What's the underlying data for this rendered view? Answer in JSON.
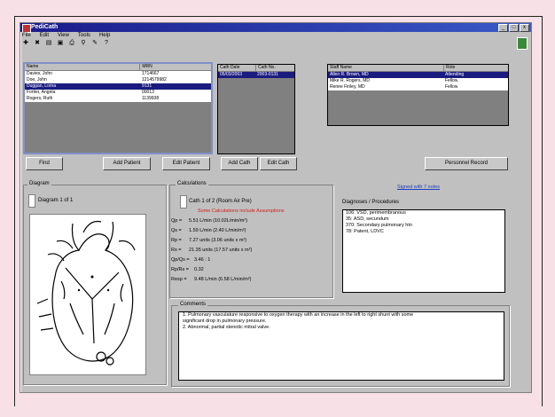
{
  "window": {
    "title": "PediCath",
    "titlebar_buttons": [
      "_",
      "□",
      "x"
    ],
    "menu": [
      "File",
      "Edit",
      "View",
      "Tools",
      "Help"
    ],
    "toolbar_icons": [
      "add-icon",
      "remove-icon",
      "database-icon",
      "save-icon",
      "print-icon",
      "search-icon",
      "tools-icon",
      "help-icon"
    ],
    "colors": {
      "title_gradient_start": "#1a1a8a",
      "selection": "#1b1b80",
      "highlight_text": "#d02020"
    }
  },
  "patients": {
    "columns": [
      "Name",
      "MRN"
    ],
    "rows": [
      {
        "name": "Davies, John",
        "mrn": "1714667"
      },
      {
        "name": "Doe, John",
        "mrn": "1214579982"
      },
      {
        "name": "Duggan, Lorna",
        "mrn": "9131"
      },
      {
        "name": "Fortier, Angela",
        "mrn": "00013"
      },
      {
        "name": "Rogers, Ruth",
        "mrn": "1139938"
      }
    ],
    "selected_index": 2
  },
  "caths": {
    "columns": [
      "Cath Date",
      "Cath No."
    ],
    "rows": [
      {
        "date": "05/03/2003",
        "number": "2003-0131"
      }
    ],
    "selected_index": 0
  },
  "staff": {
    "columns": [
      "Staff Name",
      "Role"
    ],
    "rows": [
      {
        "name": "Allen R. Brown, MD",
        "role": "Attending"
      },
      {
        "name": "Mike R. Rogers, MD",
        "role": "Fellow"
      },
      {
        "name": "Renee Finley, MD",
        "role": "Fellow"
      }
    ],
    "selected_index": 0
  },
  "buttons": {
    "find": "Find",
    "add_patient": "Add Patient",
    "edit_patient": "Edit Patient",
    "add_cath": "Add Cath",
    "edit_cath": "Edit Cath",
    "personnel_record": "Personnel Record"
  },
  "diagram": {
    "group_label": "Diagram",
    "page_label": "Diagram 1 of 1"
  },
  "calculations": {
    "group_label": "Calculations",
    "selector": "Cath 1 of 2 (Room Air Pre)",
    "note": "Some Calculations include Assumptions",
    "rows": [
      {
        "label": "Qp =",
        "value": "5.51 L/min (10.02L/min/m²)"
      },
      {
        "label": "Qs =",
        "value": "1.59 L/min (2.40 L/min/m²)"
      },
      {
        "label": "Rp =",
        "value": "7.27 units (3.06 units x m²)"
      },
      {
        "label": "Rs =",
        "value": "21.35 units (17.57 units x m²)"
      },
      {
        "label": "Qp/Qs =",
        "value": "3.46 : 1"
      },
      {
        "label": "Rp/Rs =",
        "value": "0.32"
      },
      {
        "label": "Resp =",
        "value": "9.48 L/min (6.58 L/min/m²)"
      }
    ]
  },
  "diagnoses": {
    "link": "Signed with 7 notes",
    "label": "Diagnoses / Procedures",
    "items": [
      "106: VSD, perimembranous",
      "35: ASD, secundum",
      "370: Secondary pulmonary htn",
      "78: Patent, LDVC"
    ]
  },
  "comments": {
    "group_label": "Comments",
    "lines": [
      "1. Pulmonary vasculature responsive to oxygen therapy with an increase in the left to right shunt with some",
      "significant drop in pulmonary pressure.",
      "2. Abnormal, partial stenotic mitral valve."
    ]
  }
}
